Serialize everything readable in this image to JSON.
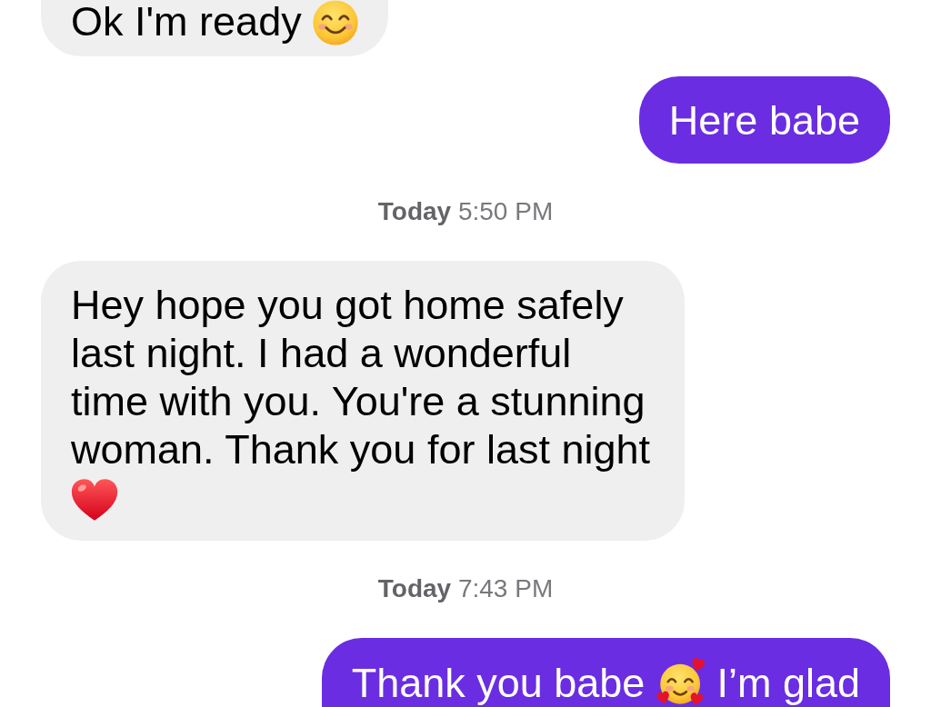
{
  "conversation": [
    {
      "kind": "received",
      "parts": [
        {
          "kind": "text",
          "text": "Ok I'm ready"
        },
        {
          "kind": "smile"
        }
      ]
    },
    {
      "kind": "sent",
      "parts": [
        {
          "kind": "text",
          "text": "Here babe"
        }
      ]
    },
    {
      "kind": "timestamp",
      "text": "**Today** 5:50 PM"
    },
    {
      "kind": "received",
      "parts": [
        {
          "kind": "text",
          "text": "Hey hope you got home safely last night. I had a wonderful time with you. You're a stunning woman. Thank you for last night"
        },
        {
          "kind": "heart"
        }
      ]
    },
    {
      "kind": "timestamp",
      "text": "**Today** 7:43 PM"
    },
    {
      "kind": "sent",
      "parts": [
        {
          "kind": "text",
          "text": "Thank you babe"
        },
        {
          "kind": "hearts"
        },
        {
          "kind": "text",
          "text": "I’m glad"
        }
      ]
    }
  ]
}
